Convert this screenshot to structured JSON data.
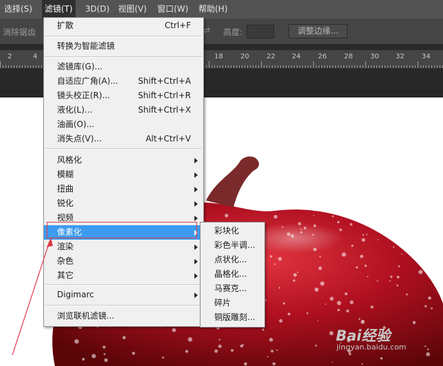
{
  "menubar": {
    "items": [
      {
        "label": "选择(S)"
      },
      {
        "label": "滤镜(T)"
      },
      {
        "label": "3D(D)"
      },
      {
        "label": "视图(V)"
      },
      {
        "label": "窗口(W)"
      },
      {
        "label": "帮助(H)"
      }
    ]
  },
  "options_bar": {
    "antialias_label": "消除锯齿",
    "height_label": "高度:",
    "height_value": "",
    "refine_edge_button": "调整边缘..."
  },
  "ruler": {
    "labels": [
      "2",
      "4",
      "18",
      "20",
      "22",
      "24",
      "26",
      "28",
      "30",
      "32",
      "34"
    ]
  },
  "filter_menu": {
    "items": [
      {
        "label": "扩散",
        "shortcut": "Ctrl+F"
      },
      {
        "label": "转换为智能滤镜",
        "shortcut": ""
      },
      {
        "label": "滤镜库(G)...",
        "shortcut": ""
      },
      {
        "label": "自适应广角(A)...",
        "shortcut": "Shift+Ctrl+A"
      },
      {
        "label": "镜头校正(R)...",
        "shortcut": "Shift+Ctrl+R"
      },
      {
        "label": "液化(L)...",
        "shortcut": "Shift+Ctrl+X"
      },
      {
        "label": "油画(O)...",
        "shortcut": ""
      },
      {
        "label": "消失点(V)...",
        "shortcut": "Alt+Ctrl+V"
      },
      {
        "label": "风格化",
        "shortcut": ""
      },
      {
        "label": "模糊",
        "shortcut": ""
      },
      {
        "label": "扭曲",
        "shortcut": ""
      },
      {
        "label": "锐化",
        "shortcut": ""
      },
      {
        "label": "视频",
        "shortcut": ""
      },
      {
        "label": "像素化",
        "shortcut": ""
      },
      {
        "label": "渲染",
        "shortcut": ""
      },
      {
        "label": "杂色",
        "shortcut": ""
      },
      {
        "label": "其它",
        "shortcut": ""
      },
      {
        "label": "Digimarc",
        "shortcut": ""
      },
      {
        "label": "浏览联机滤镜...",
        "shortcut": ""
      }
    ],
    "highlighted": "像素化"
  },
  "pixelate_submenu": {
    "items": [
      {
        "label": "彩块化"
      },
      {
        "label": "彩色半调..."
      },
      {
        "label": "点状化..."
      },
      {
        "label": "晶格化..."
      },
      {
        "label": "马赛克..."
      },
      {
        "label": "碎片"
      },
      {
        "label": "铜版雕刻..."
      }
    ]
  },
  "watermark": {
    "brand": "Bai经验",
    "url": "jingyan.baidu.com"
  },
  "colors": {
    "menu_highlight": "#3d9bf0",
    "annotation_red": "#e03a48",
    "apple_red": "#b01020"
  }
}
